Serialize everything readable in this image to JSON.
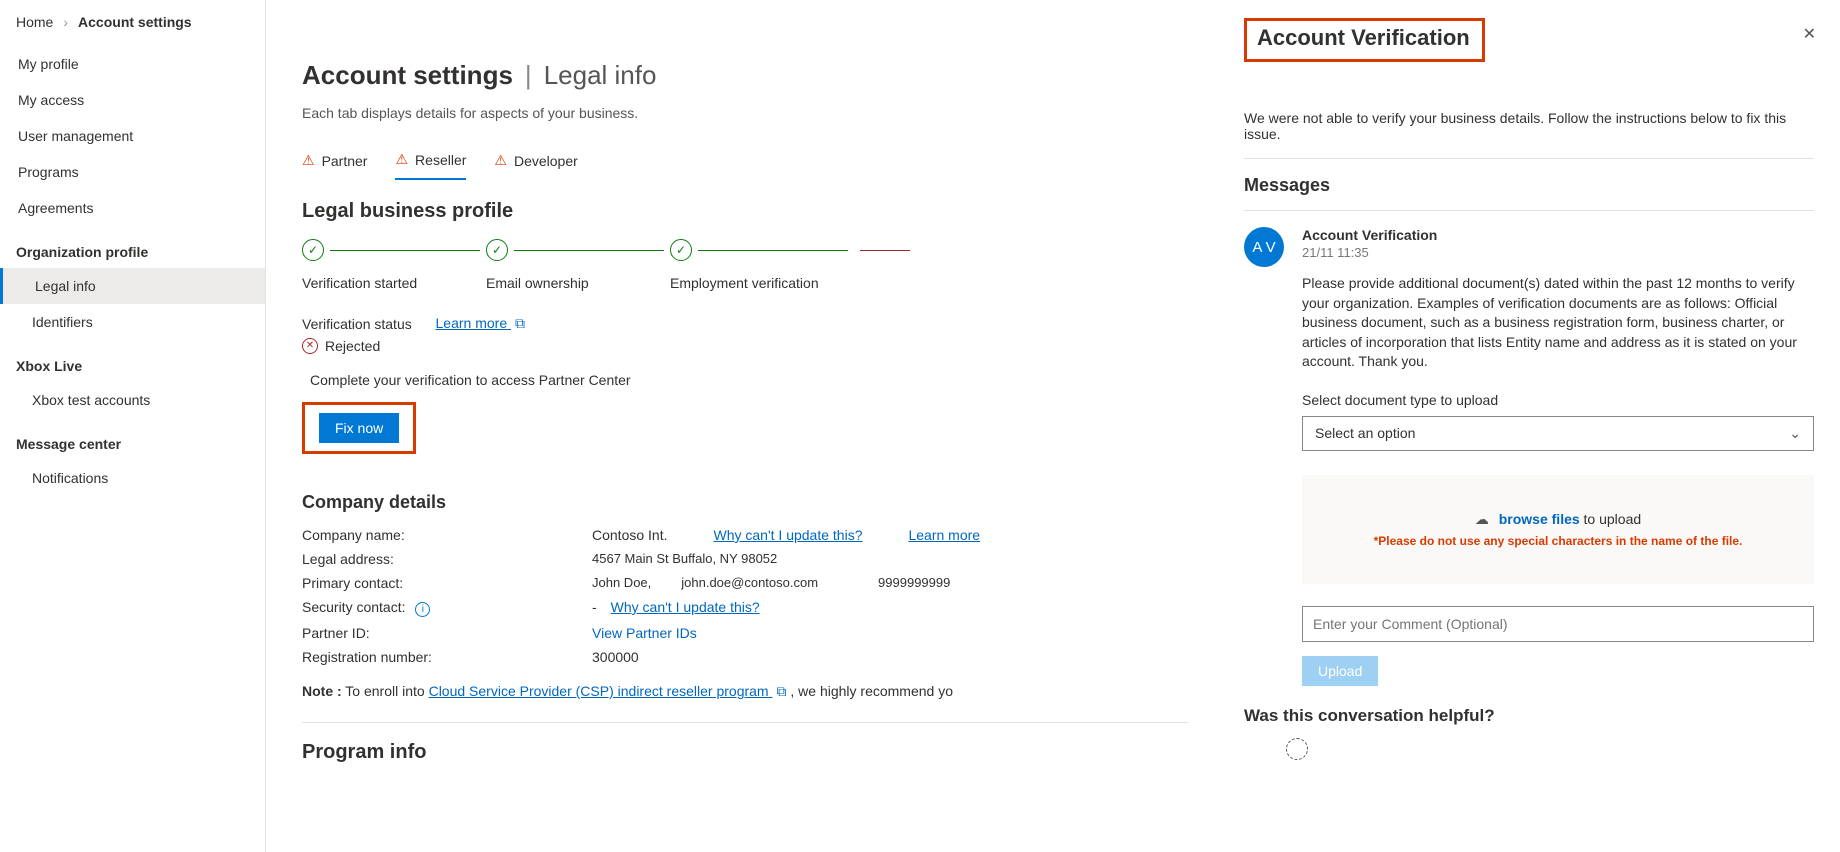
{
  "breadcrumb": {
    "home": "Home",
    "current": "Account settings"
  },
  "sidebar": {
    "myProfile": "My profile",
    "myAccess": "My access",
    "userMgmt": "User management",
    "programs": "Programs",
    "agreements": "Agreements",
    "orgHeader": "Organization profile",
    "legalInfo": "Legal info",
    "identifiers": "Identifiers",
    "xboxHeader": "Xbox Live",
    "xboxTest": "Xbox test accounts",
    "msgHeader": "Message center",
    "notifications": "Notifications"
  },
  "page": {
    "title": "Account settings",
    "subTitle": "Legal info",
    "desc": "Each tab displays details for aspects of your business.",
    "tabs": {
      "partner": "Partner",
      "reseller": "Reseller",
      "developer": "Developer"
    },
    "legalHeader": "Legal business profile",
    "steps": {
      "started": "Verification started",
      "email": "Email ownership",
      "employ": "Employment verification"
    },
    "status": {
      "label": "Verification status",
      "learn": "Learn more",
      "rejected": "Rejected"
    },
    "complete": "Complete your verification to access Partner Center",
    "fixNow": "Fix now",
    "company": {
      "header": "Company details",
      "nameLbl": "Company name:",
      "nameVal": "Contoso Int.",
      "why1": "Why can't I update this?",
      "learn": "Learn more",
      "addrLbl": "Legal address:",
      "addr": "4567 Main St Buffalo, NY 98052",
      "contactLbl": "Primary contact:",
      "contactName": "John Doe,",
      "contactEmail": "john.doe@contoso.com",
      "contactPhone": "9999999999",
      "secLbl": "Security contact:",
      "secVal": "-",
      "why2": "Why can't I update this?",
      "partnerIdLbl": "Partner ID:",
      "partnerIdLink": "View Partner IDs",
      "regNumLbl": "Registration number:",
      "regNumVal": "300000",
      "noteLabel": "Note :",
      "noteText": " To enroll into ",
      "noteLink": "Cloud Service Provider (CSP) indirect reseller program",
      "noteRest": " , we highly recommend yo"
    },
    "programInfo": "Program info"
  },
  "panel": {
    "title": "Account Verification",
    "desc": "We were not able to verify your business details. Follow the instructions below to fix this issue.",
    "messagesHeader": "Messages",
    "avatar": "A V",
    "sender": "Account Verification",
    "time": "21/11 11:35",
    "msgText": "Please provide additional document(s) dated within the past 12 months to verify your organization. Examples of verification documents are as follows: Official business document, such as a business registration form, business charter, or articles of incorporation that lists Entity name and address as it is stated on your account. Thank you.",
    "selectLabel": "Select document type to upload",
    "selectPlaceholder": "Select an option",
    "browseFiles": "browse files",
    "toUpload": " to upload",
    "uploadWarn": "*Please do not use any special characters in the name of the file.",
    "commentPlaceholder": "Enter your Comment (Optional)",
    "uploadBtn": "Upload",
    "helpful": "Was this conversation helpful?"
  }
}
